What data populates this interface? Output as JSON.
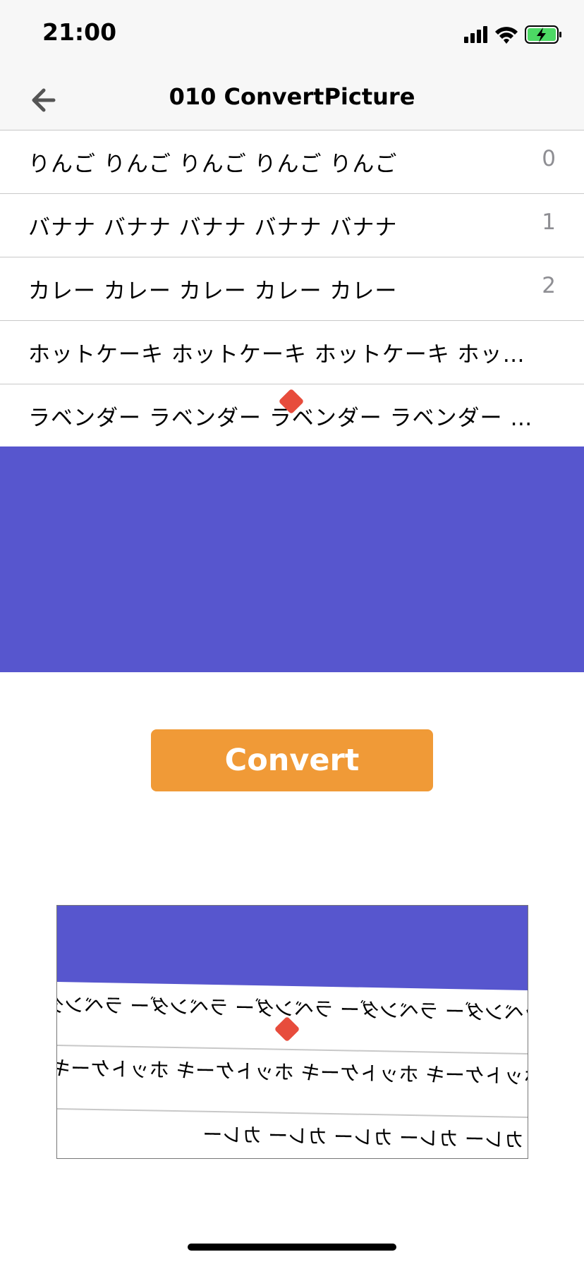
{
  "status": {
    "time": "21:00"
  },
  "nav": {
    "title": "010 ConvertPicture"
  },
  "list": [
    {
      "text": "りんご りんご りんご りんご りんご",
      "num": "0"
    },
    {
      "text": "バナナ バナナ バナナ バナナ バナナ",
      "num": "1"
    },
    {
      "text": "カレー カレー カレー カレー カレー",
      "num": "2"
    },
    {
      "text": "ホットケーキ ホットケーキ ホットケーキ ホットケーキ",
      "num": ""
    },
    {
      "text": "ラベンダー ラベンダー ラベンダー ラベンダー ラベンダー",
      "num": ""
    }
  ],
  "colors": {
    "purple": "#5756ce",
    "orange": "#f09a37",
    "marker": "#e74c3c",
    "battery": "#4cd964"
  },
  "button": {
    "label": "Convert"
  },
  "preview": {
    "rows": [
      "ラベンダー ラベンダー ラベンダー ラベンダー ラベンダー",
      "ホットケーキ ホットケーキ ホットケーキ ホットケーキ",
      "カレー カレー カレー カレー カレー"
    ]
  }
}
